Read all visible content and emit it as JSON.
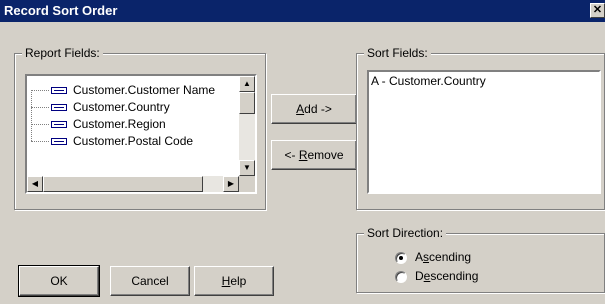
{
  "window": {
    "title": "Record Sort Order"
  },
  "report_fields": {
    "label": "Report Fields:",
    "items": [
      "Customer.Customer Name",
      "Customer.Country",
      "Customer.Region",
      "Customer.Postal Code"
    ]
  },
  "buttons": {
    "add_pre": "",
    "add_u": "A",
    "add_post": "dd ->",
    "remove_pre": "<- ",
    "remove_u": "R",
    "remove_post": "emove",
    "ok": "OK",
    "cancel": "Cancel",
    "help_u": "H",
    "help_post": "elp"
  },
  "sort_fields": {
    "label": "Sort Fields:",
    "items": [
      "A - Customer.Country"
    ]
  },
  "sort_direction": {
    "label": "Sort Direction:",
    "ascending_pre": "A",
    "ascending_u": "s",
    "ascending_post": "cending",
    "descending_pre": "D",
    "descending_u": "e",
    "descending_post": "scending",
    "selected": "ascending"
  },
  "colors": {
    "titlebar": "#0a246a",
    "dialog": "#d4d0c8"
  }
}
